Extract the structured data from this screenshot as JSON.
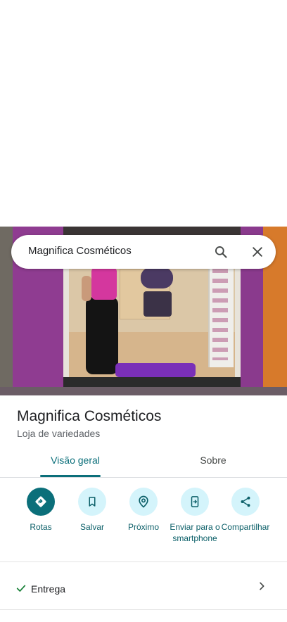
{
  "search": {
    "query": "Magnifica Cosméticos"
  },
  "place": {
    "name": "Magnifica Cosméticos",
    "category": "Loja de variedades"
  },
  "tabs": [
    {
      "label": "Visão geral",
      "selected": true
    },
    {
      "label": "Sobre",
      "selected": false
    }
  ],
  "actions": [
    {
      "label": "Rotas",
      "icon": "directions-icon"
    },
    {
      "label": "Salvar",
      "icon": "bookmark-icon"
    },
    {
      "label": "Próximo",
      "icon": "nearby-icon"
    },
    {
      "label": "Enviar para o smartphone",
      "icon": "send-to-phone-icon"
    },
    {
      "label": "Compartilhar",
      "icon": "share-icon"
    }
  ],
  "attributes": [
    {
      "label": "Entrega",
      "icon": "check-icon",
      "available": true
    }
  ],
  "colors": {
    "accent": "#0b6f7a",
    "action_bg": "#d4f4fb",
    "check": "#188038"
  }
}
